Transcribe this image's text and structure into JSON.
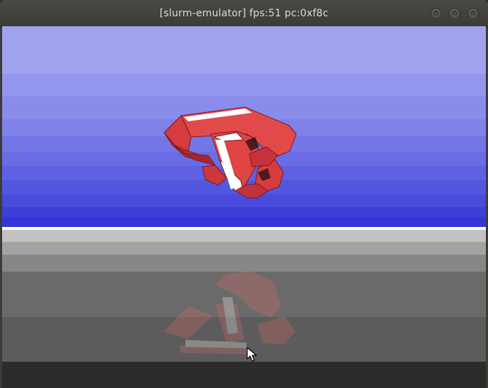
{
  "window": {
    "title": "[slurm-emulator] fps:51 pc:0xf8c"
  },
  "colors": {
    "titlebar": "#3c3b37",
    "title_text": "#dfdbd2",
    "horizon": "#ffffff",
    "knot_base": "#e04848",
    "knot_highlight": "#ffffff",
    "knot_shadow": "#8a1e24",
    "sky_bands": [
      "#a0a2ef",
      "#9b9cee",
      "#8f90ec",
      "#8486ea",
      "#787ae8",
      "#6d70e5",
      "#6163e2",
      "#5659df",
      "#4b4ddc",
      "#3f42d9",
      "#3335d6"
    ],
    "floor_bands": [
      "#c2c2c2",
      "#a3a3a3",
      "#878787",
      "#6c6c6c",
      "#5c5c5c"
    ]
  },
  "icons": {
    "cursor": "mouse-pointer-icon"
  }
}
